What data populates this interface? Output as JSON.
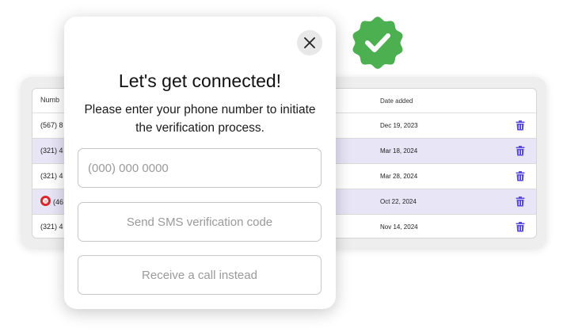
{
  "table": {
    "headers": {
      "number": "Numb",
      "date": "Date added"
    },
    "rows": [
      {
        "number": "(567) 8",
        "date": "Dec 19, 2023",
        "alt": false,
        "icon": ""
      },
      {
        "number": "(321) 4",
        "date": "Mar 18, 2024",
        "alt": true,
        "icon": ""
      },
      {
        "number": "(321) 4",
        "date": "Mar 28, 2024",
        "alt": false,
        "icon": ""
      },
      {
        "number": "(46",
        "date": "Oct 22, 2024",
        "alt": true,
        "icon": "twilio-icon"
      },
      {
        "number": "(321) 4",
        "date": "Nov 14, 2024",
        "alt": false,
        "icon": ""
      }
    ]
  },
  "modal": {
    "title": "Let's get connected!",
    "subtitle": "Please enter your phone number to initiate the verification process.",
    "phone_placeholder": "(000) 000 0000",
    "sms_button": "Send SMS verification code",
    "call_button": "Receive a call instead"
  },
  "colors": {
    "badge_green": "#4caf50",
    "trash_purple": "#5b4bdb",
    "row_highlight": "#e7e5f6"
  },
  "icons": {
    "badge": "verified-check-badge-icon",
    "delete": "trash-icon",
    "close": "close-icon"
  }
}
